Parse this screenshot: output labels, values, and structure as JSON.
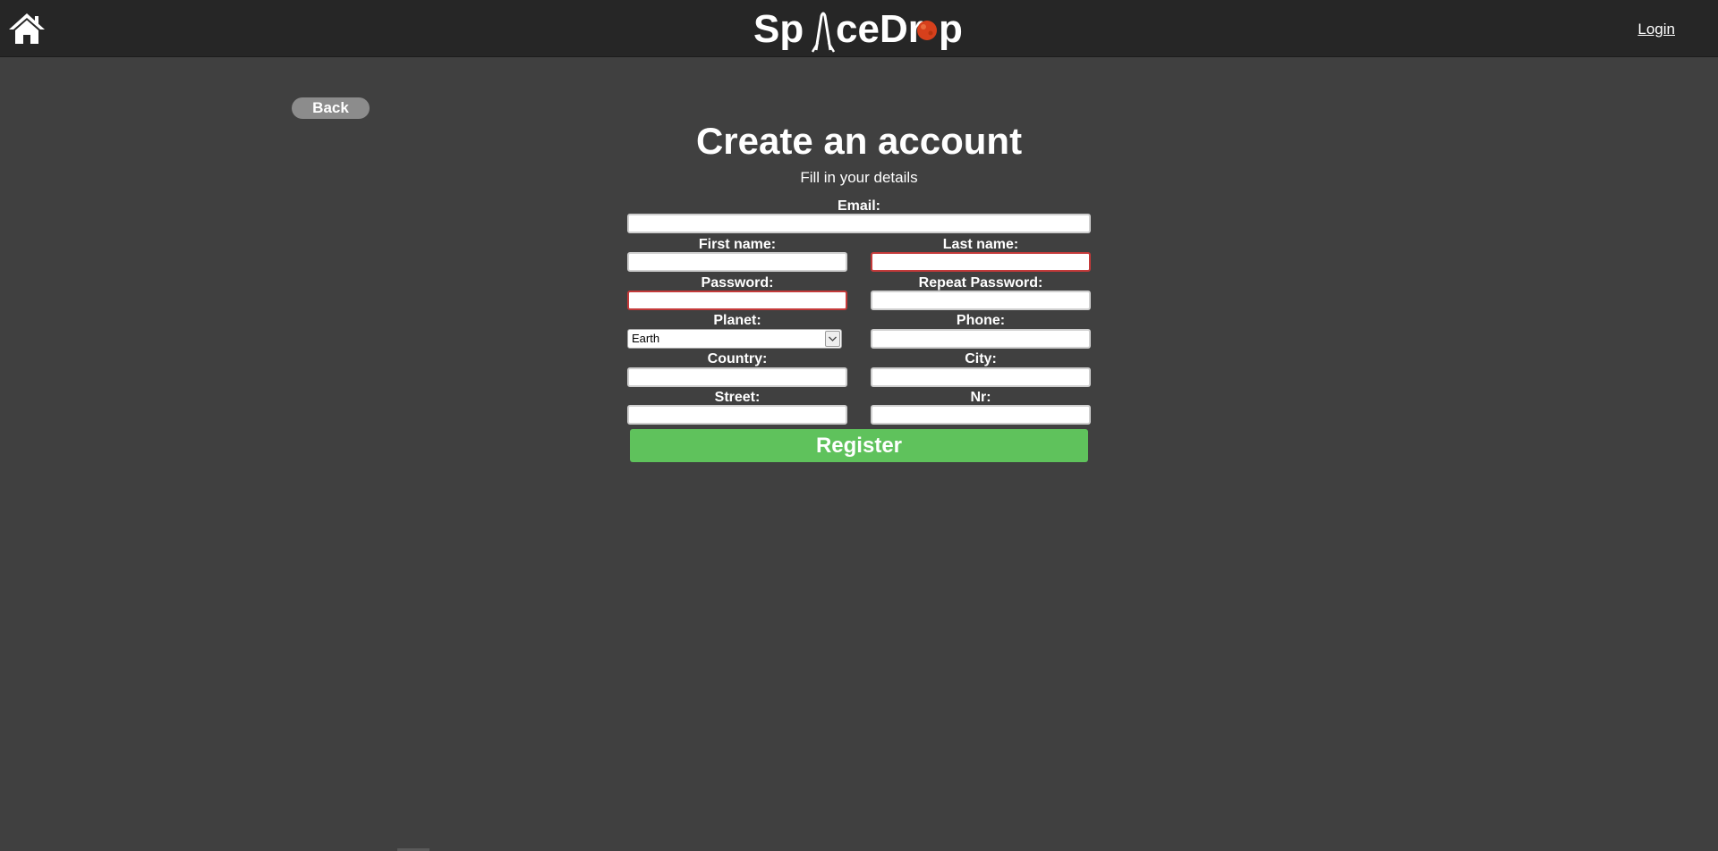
{
  "header": {
    "home_icon": "home-icon",
    "logo_text": "SpaceDrop",
    "login_label": "Login"
  },
  "back_label": "Back",
  "title": "Create an account",
  "subtitle": "Fill in your details",
  "form": {
    "email_label": "Email:",
    "first_name_label": "First name:",
    "last_name_label": "Last name:",
    "password_label": "Password:",
    "repeat_password_label": "Repeat Password:",
    "planet_label": "Planet:",
    "planet_value": "Earth",
    "phone_label": "Phone:",
    "country_label": "Country:",
    "city_label": "City:",
    "street_label": "Street:",
    "nr_label": "Nr:"
  },
  "register_label": "Register",
  "colors": {
    "background": "#404040",
    "header": "#262626",
    "accent_green": "#5fc25c",
    "invalid_red": "#c43a3a"
  }
}
